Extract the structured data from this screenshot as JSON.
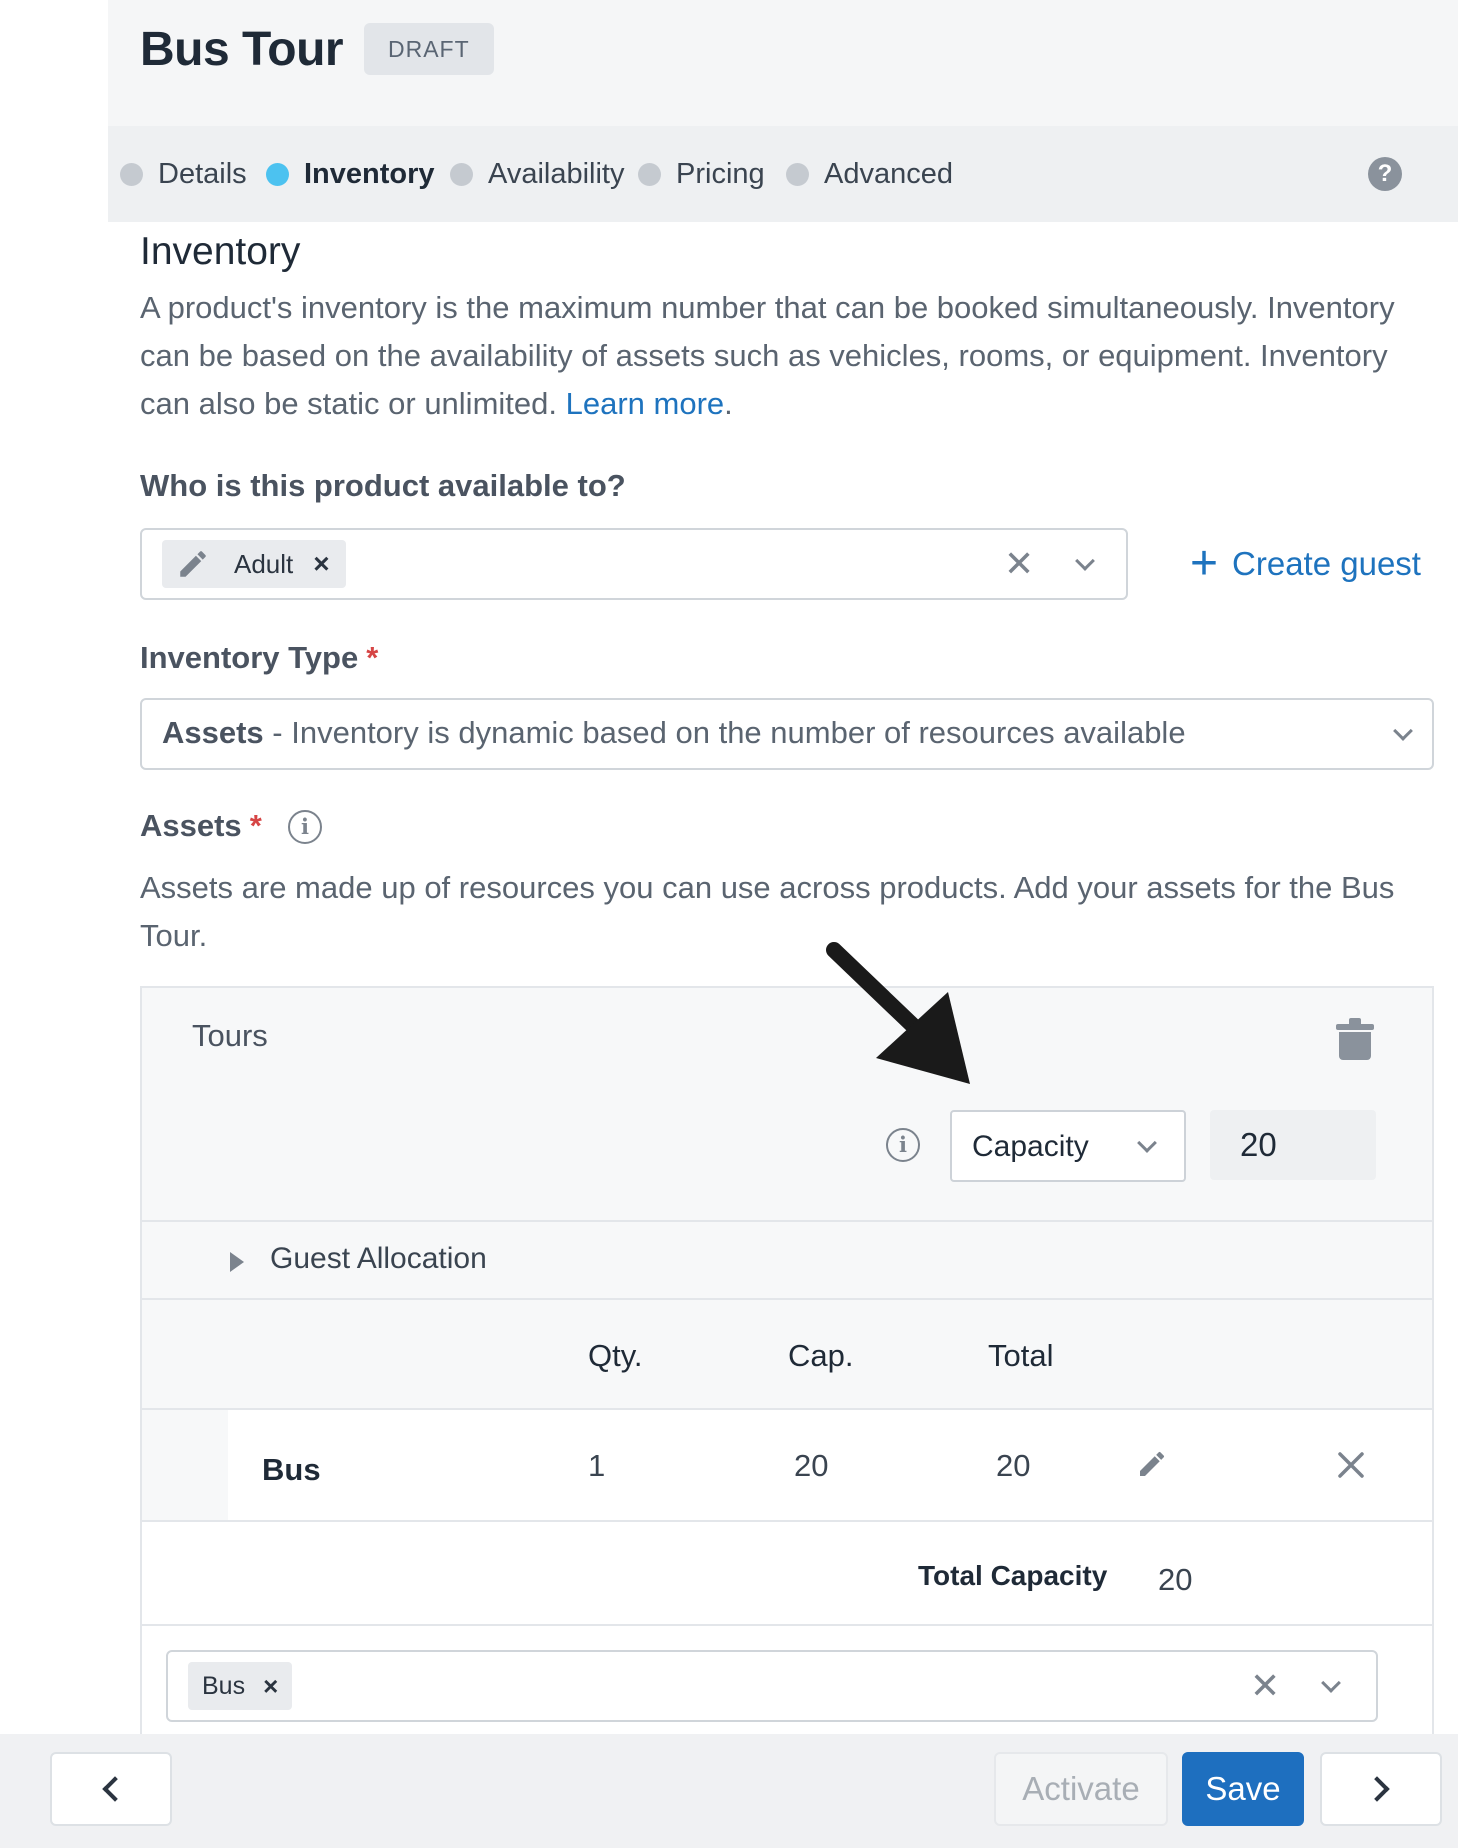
{
  "header": {
    "title": "Bus Tour",
    "badge": "DRAFT"
  },
  "steps": [
    {
      "label": "Details",
      "active": false
    },
    {
      "label": "Inventory",
      "active": true
    },
    {
      "label": "Availability",
      "active": false
    },
    {
      "label": "Pricing",
      "active": false
    },
    {
      "label": "Advanced",
      "active": false
    }
  ],
  "help_icon_glyph": "?",
  "inventory": {
    "title": "Inventory",
    "description": "A product's inventory is the maximum number that can be booked simultaneously. Inventory can be based on the availability of assets such as vehicles, rooms, or equipment. Inventory can also be static or unlimited.",
    "learn_more": "Learn more",
    "learn_more_suffix": "."
  },
  "guests": {
    "label": "Who is this product available to?",
    "chips": [
      {
        "icon": "pencil-icon",
        "label": "Adult",
        "remove": "×"
      }
    ],
    "clear": "✕",
    "create_guest": "Create guest",
    "create_guest_icon": "+"
  },
  "inventory_type": {
    "label": "Inventory Type",
    "required_mark": "*",
    "selected_bold": "Assets",
    "selected_rest": " - Inventory is dynamic based on the number of resources available"
  },
  "assets": {
    "label": "Assets",
    "required_mark": "*",
    "info_glyph": "i",
    "description": "Assets are made up of resources you can use across products. Add your assets for the Bus Tour."
  },
  "asset_group": {
    "name": "Tours",
    "mode_select": "Capacity",
    "mode_value": "20",
    "guest_allocation": "Guest Allocation",
    "columns": [
      "Qty.",
      "Cap.",
      "Total"
    ],
    "rows": [
      {
        "name": "Bus",
        "qty": "1",
        "cap": "20",
        "total": "20"
      }
    ],
    "total_label": "Total Capacity",
    "total_value": "20",
    "asset_chips": [
      {
        "label": "Bus",
        "remove": "×"
      }
    ],
    "clear": "✕"
  },
  "footer": {
    "activate": "Activate",
    "save": "Save"
  },
  "colors": {
    "accent": "#1e73be",
    "active_step": "#4cc2f0",
    "required": "#d64545",
    "save_button": "#1e6fbf"
  }
}
